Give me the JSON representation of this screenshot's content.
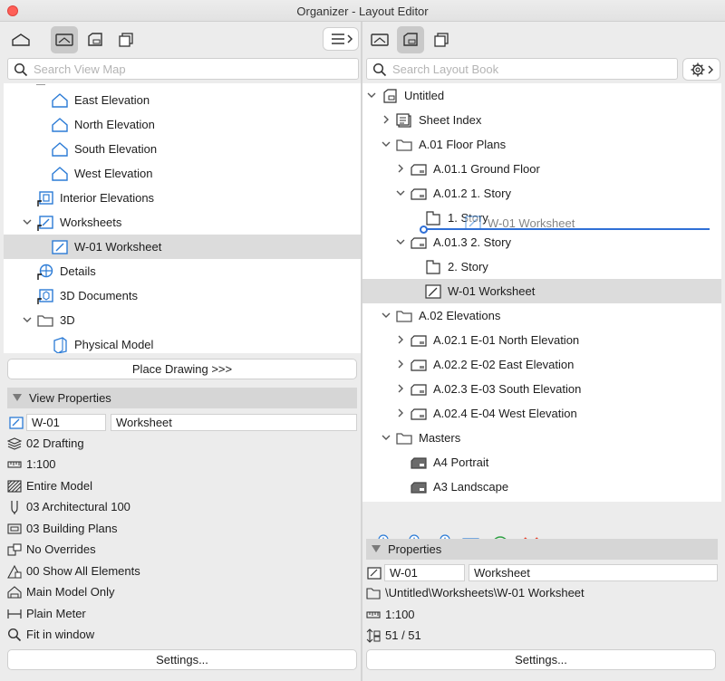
{
  "window": {
    "title": "Organizer - Layout Editor"
  },
  "left": {
    "search_placeholder": "Search View Map",
    "tree": [
      {
        "label": "East Elevation",
        "icon": "elevation-icon"
      },
      {
        "label": "North Elevation",
        "icon": "elevation-icon"
      },
      {
        "label": "South Elevation",
        "icon": "elevation-icon"
      },
      {
        "label": "West Elevation",
        "icon": "elevation-icon"
      },
      {
        "label": "Interior Elevations",
        "icon": "interior-elevations-icon"
      },
      {
        "label": "Worksheets",
        "icon": "worksheets-icon",
        "expanded": true
      },
      {
        "label": "W-01 Worksheet",
        "icon": "worksheet-icon",
        "selected": true
      },
      {
        "label": "Details",
        "icon": "details-icon"
      },
      {
        "label": "3D Documents",
        "icon": "3d-documents-icon"
      },
      {
        "label": "3D",
        "icon": "folder-icon",
        "expanded": true
      },
      {
        "label": "Physical Model",
        "icon": "physical-model-icon"
      }
    ],
    "place_button": "Place Drawing >>>",
    "view_properties": {
      "header": "View Properties",
      "id": "W-01",
      "name": "Worksheet",
      "rows": [
        {
          "text": "02 Drafting",
          "icon": "layer-icon"
        },
        {
          "text": "1:100",
          "icon": "scale-icon"
        },
        {
          "text": "Entire Model",
          "icon": "structure-icon"
        },
        {
          "text": "03 Architectural 100",
          "icon": "pen-set-icon"
        },
        {
          "text": "03 Building Plans",
          "icon": "model-view-icon"
        },
        {
          "text": "No Overrides",
          "icon": "override-icon"
        },
        {
          "text": "00 Show All Elements",
          "icon": "renovation-icon"
        },
        {
          "text": "Main Model Only",
          "icon": "model-only-icon"
        },
        {
          "text": "Plain Meter",
          "icon": "dimension-icon"
        },
        {
          "text": "Fit in window",
          "icon": "zoom-icon"
        }
      ],
      "settings_button": "Settings..."
    }
  },
  "right": {
    "search_placeholder": "Search Layout Book",
    "tree": [
      {
        "label": "Untitled",
        "icon": "layout-book-icon",
        "level": 0,
        "chevron": "down"
      },
      {
        "label": "Sheet Index",
        "icon": "sheet-index-icon",
        "level": 1,
        "chevron": "right"
      },
      {
        "label": "A.01 Floor Plans",
        "icon": "folder-icon",
        "level": 1,
        "chevron": "down"
      },
      {
        "label": "A.01.1 Ground Floor",
        "icon": "layout-icon",
        "level": 2,
        "chevron": "right"
      },
      {
        "label": "A.01.2 1. Story",
        "icon": "layout-icon",
        "level": 2,
        "chevron": "down"
      },
      {
        "label": "1. Story",
        "icon": "drawing-icon",
        "level": 3,
        "chevron": ""
      },
      {
        "label": "A.01.3 2. Story",
        "icon": "layout-icon",
        "level": 2,
        "chevron": "down"
      },
      {
        "label": "2. Story",
        "icon": "drawing-icon",
        "level": 3,
        "chevron": ""
      },
      {
        "label": "W-01 Worksheet",
        "icon": "worksheet-icon",
        "level": 3,
        "chevron": "",
        "selected": true
      },
      {
        "label": "A.02 Elevations",
        "icon": "folder-icon",
        "level": 1,
        "chevron": "down"
      },
      {
        "label": "A.02.1 E-01 North Elevation",
        "icon": "layout-icon",
        "level": 2,
        "chevron": "right"
      },
      {
        "label": "A.02.2 E-02 East Elevation",
        "icon": "layout-icon",
        "level": 2,
        "chevron": "right"
      },
      {
        "label": "A.02.3 E-03 South Elevation",
        "icon": "layout-icon",
        "level": 2,
        "chevron": "right"
      },
      {
        "label": "A.02.4 E-04 West Elevation",
        "icon": "layout-icon",
        "level": 2,
        "chevron": "right"
      },
      {
        "label": "Masters",
        "icon": "folder-icon",
        "level": 1,
        "chevron": "down"
      },
      {
        "label": "A4 Portrait",
        "icon": "master-icon",
        "level": 2,
        "chevron": ""
      },
      {
        "label": "A3 Landscape",
        "icon": "master-icon",
        "level": 2,
        "chevron": ""
      }
    ],
    "drag_ghost_label": "W-01 Worksheet",
    "properties": {
      "header": "Properties",
      "id": "W-01",
      "name": "Worksheet",
      "path": "\\Untitled\\Worksheets\\W-01 Worksheet",
      "scale": "1:100",
      "pages": "51 / 51",
      "settings_button": "Settings..."
    }
  },
  "colors": {
    "accent": "#2f6fd6",
    "icon_blue": "#2b7bd6",
    "delete_red": "#e8412c",
    "refresh_green": "#2ea043"
  }
}
